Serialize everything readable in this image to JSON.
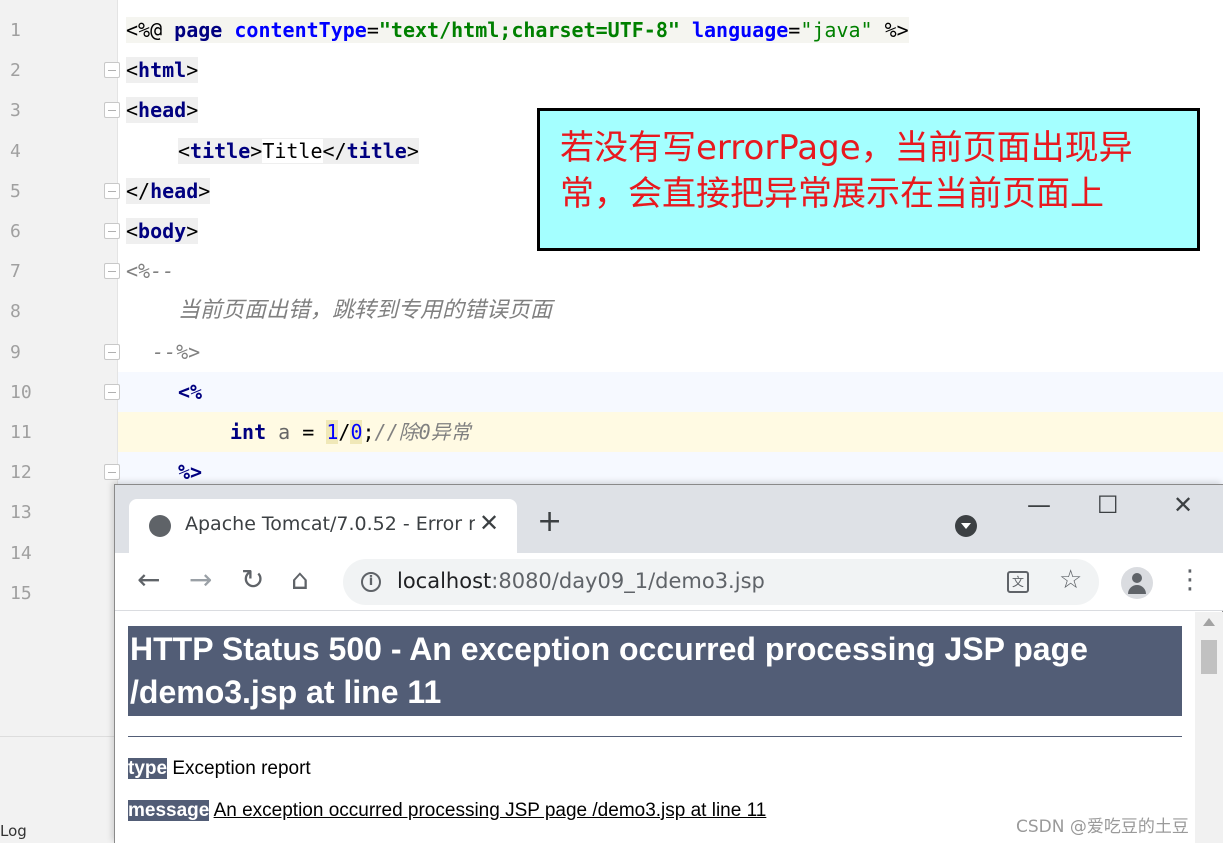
{
  "editor": {
    "line_numbers": [
      "1",
      "2",
      "3",
      "4",
      "5",
      "6",
      "7",
      "8",
      "9",
      "10",
      "11",
      "12",
      "13",
      "14",
      "15"
    ],
    "line1": {
      "open": "<%@ ",
      "page": "page ",
      "ct_attr": "contentType",
      "eq1": "=",
      "ct_val": "\"text/html;charset=UTF-8\"",
      "lang_attr": " language",
      "eq2": "=",
      "lang_val": "\"java\"",
      "close": " %>"
    },
    "line2": {
      "lt": "<",
      "tag": "html",
      "gt": ">"
    },
    "line3": {
      "lt": "<",
      "tag": "head",
      "gt": ">"
    },
    "line4": {
      "lt1": "<",
      "tag1": "title",
      "gt1": ">",
      "text": "Title",
      "lt2": "</",
      "tag2": "title",
      "gt2": ">"
    },
    "line5": {
      "lt": "</",
      "tag": "head",
      "gt": ">"
    },
    "line6": {
      "lt": "<",
      "tag": "body",
      "gt": ">"
    },
    "line7": "<%--",
    "line8": "当前页面出错，跳转到专用的错误页面",
    "line9": "--%>",
    "line10": "<%",
    "line11": {
      "type": "int",
      "var": " a ",
      "eq": "= ",
      "num1": "1",
      "slash": "/",
      "num2": "0",
      "semi": ";",
      "comment": "//除0异常"
    },
    "line12": "%>",
    "log_tab": "Log"
  },
  "callout": {
    "text": "若没有写errorPage，当前页面出现异常，会直接把异常展示在当前页面上",
    "bg_color": "#a4ffff",
    "text_color": "#e8191f"
  },
  "browser": {
    "tab_title": "Apache Tomcat/7.0.52 - Error r",
    "tab_close": "✕",
    "new_tab": "+",
    "window_minimize": "—",
    "window_maximize": "☐",
    "window_close": "✕",
    "back": "←",
    "forward": "→",
    "reload": "↻",
    "home": "⌂",
    "url_host": "localhost",
    "url_path": ":8080/day09_1/demo3.jsp",
    "star": "☆",
    "menu": "⋮",
    "info": "i",
    "translate": "文"
  },
  "error_page": {
    "heading": "HTTP Status 500 - An exception occurred processing JSP page /demo3.jsp at line 11",
    "type_label": "type",
    "type_value": " Exception report",
    "message_label": "message",
    "message_value": "An exception occurred processing JSP page /demo3.jsp at line 11",
    "heading_bg": "#525d76"
  },
  "watermark": "CSDN @爱吃豆的土豆"
}
